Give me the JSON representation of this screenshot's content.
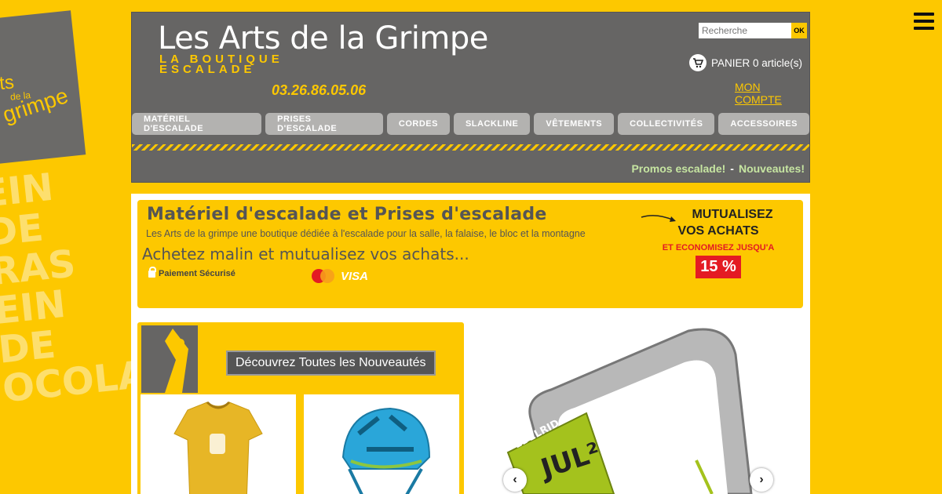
{
  "site": {
    "title": "Les Arts de la Grimpe",
    "tagline": "LA BOUTIQUE ESCALADE",
    "phone": "03.26.86.05.06"
  },
  "deco": {
    "logo_line1": "ts",
    "logo_line2": "de la",
    "logo_line3": "grimpe",
    "slogan": "EIN DE RAS EIN DE OCOLAT"
  },
  "search": {
    "placeholder": "Recherche",
    "button_label": "OK"
  },
  "cart": {
    "label": "PANIER 0 article(s)"
  },
  "account": {
    "label": "MON COMPTE"
  },
  "nav": {
    "items": [
      {
        "label": "MATÉRIEL D'ESCALADE"
      },
      {
        "label": "PRISES D'ESCALADE"
      },
      {
        "label": "CORDES"
      },
      {
        "label": "SLACKLINE"
      },
      {
        "label": "VÊTEMENTS"
      },
      {
        "label": "COLLECTIVITÉS"
      },
      {
        "label": "ACCESSOIRES"
      }
    ]
  },
  "promo": {
    "promos": "Promos escalade!",
    "separator": "-",
    "nouveautes": "Nouveautes!"
  },
  "banner": {
    "title": "Matériel d'escalade et Prises d'escalade",
    "subtitle": "Les Arts de la grimpe une boutique dédiée à l'escalade pour la salle, la falaise, le bloc et la montagne",
    "cta": "Achetez malin et mutualisez vos achats...",
    "secure": "Paiement Sécurisé",
    "mastercard": "MasterCard",
    "visa": "VISA",
    "mutu_line1": "MUTUALISEZ",
    "mutu_line2": "VOS ACHATS",
    "mutu_line3": "ET ECONOMISEZ JUSQU'A",
    "mutu_pct": "15 %"
  },
  "nouveautes": {
    "button": "Découvrez Toutes les Nouveautés"
  },
  "slider": {
    "product_text": "JUL²",
    "brand": "EDELRID"
  },
  "colors": {
    "brand_yellow": "#fdc800",
    "header_grey": "#666564",
    "accent_red": "#e41b23",
    "promo_green": "#c6e5a1"
  }
}
